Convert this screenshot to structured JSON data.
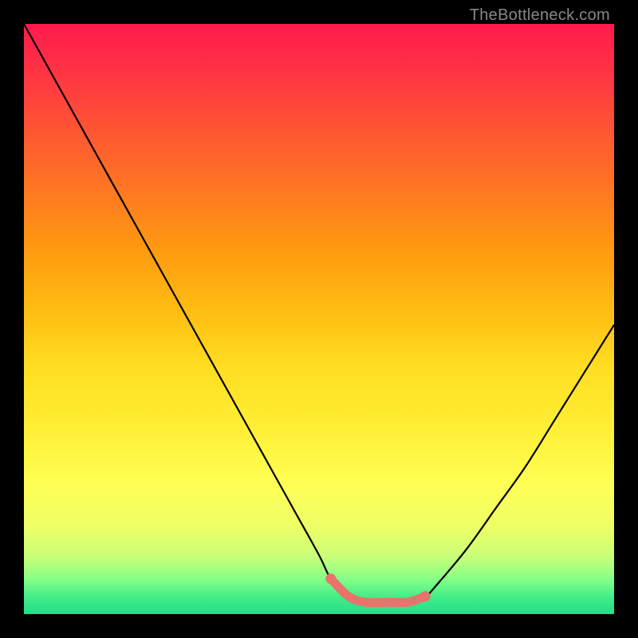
{
  "watermark": "TheBottleneck.com",
  "chart_data": {
    "type": "line",
    "title": "",
    "xlabel": "",
    "ylabel": "",
    "xlim": [
      0,
      100
    ],
    "ylim": [
      0,
      100
    ],
    "series": [
      {
        "name": "bottleneck-curve",
        "x": [
          0,
          5,
          10,
          15,
          20,
          25,
          30,
          35,
          40,
          45,
          50,
          52,
          55,
          58,
          62,
          65,
          68,
          70,
          75,
          80,
          85,
          90,
          95,
          100
        ],
        "y": [
          100,
          91,
          82,
          73,
          64,
          55,
          46,
          37,
          28,
          19,
          10,
          6,
          3,
          2,
          2,
          2,
          3,
          5,
          11,
          18,
          25,
          33,
          41,
          49
        ],
        "color": "#000000"
      },
      {
        "name": "optimal-highlight",
        "x": [
          52,
          55,
          58,
          62,
          65,
          68
        ],
        "y": [
          6,
          3,
          2,
          2,
          2,
          3
        ],
        "color": "#e8736b"
      }
    ],
    "gradient": {
      "top_color": "#ff1a4d",
      "bottom_color": "#22dd88"
    }
  }
}
